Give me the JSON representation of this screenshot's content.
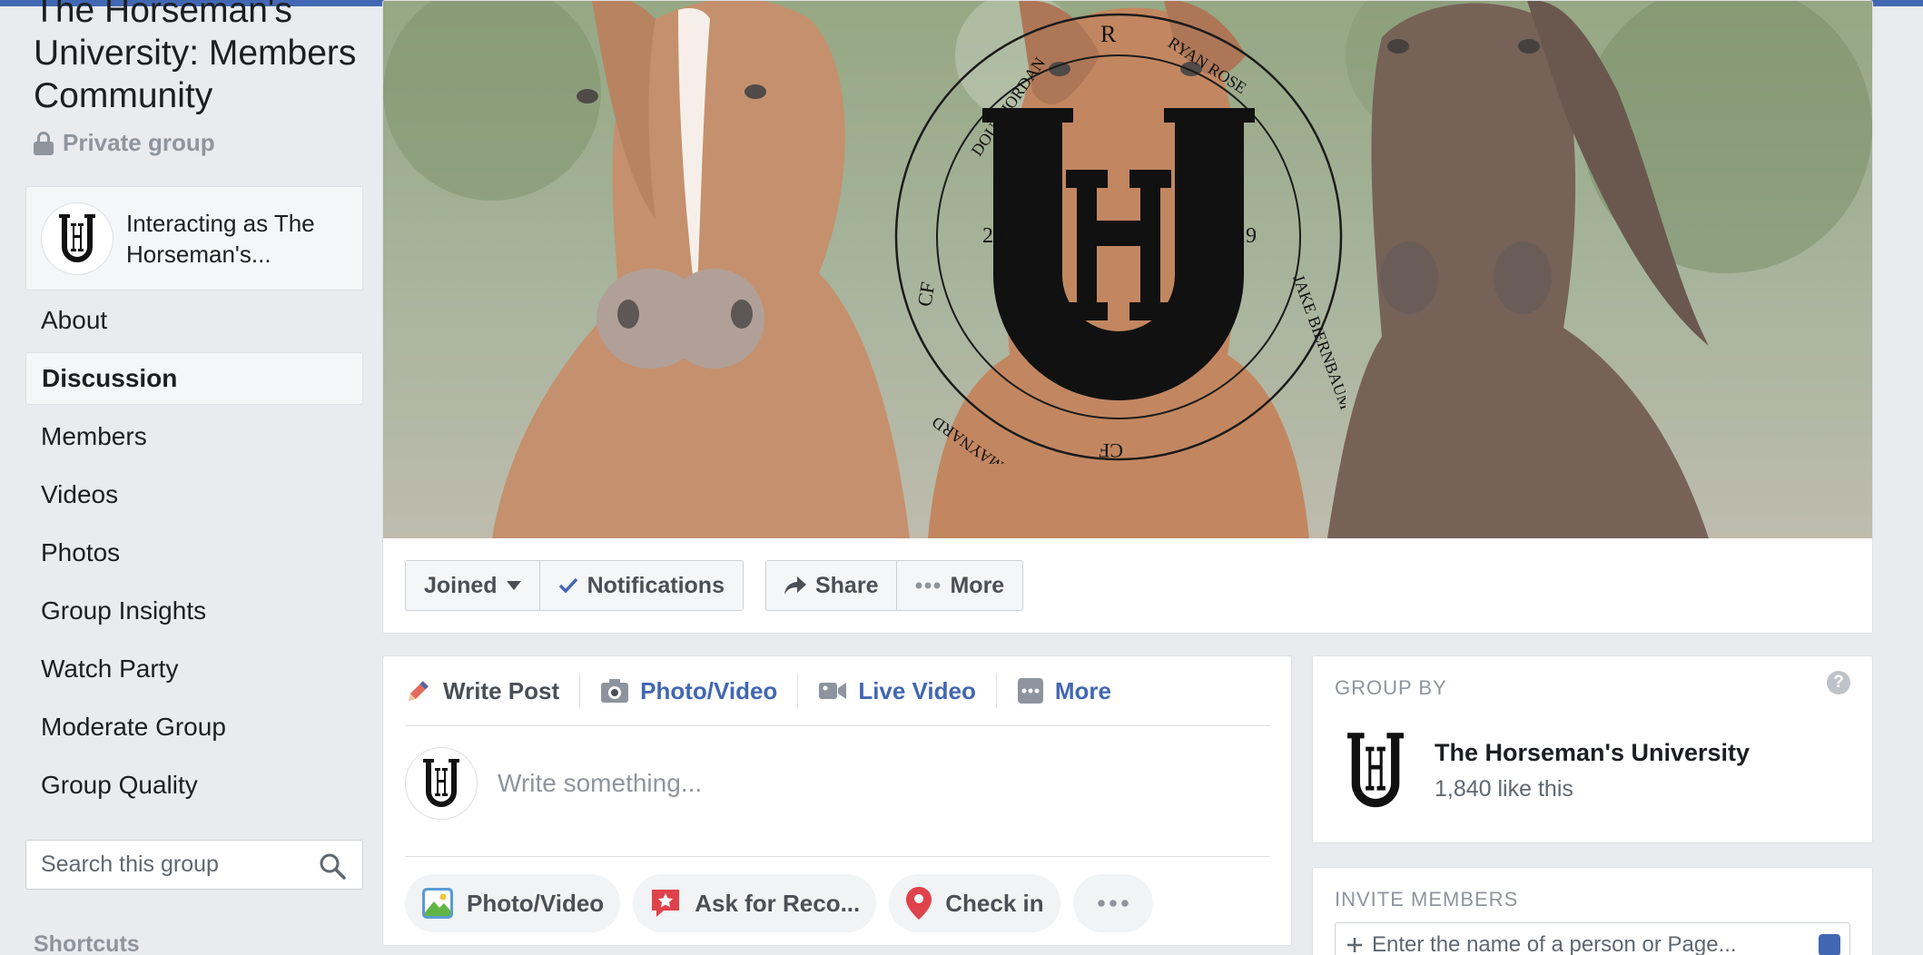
{
  "group": {
    "title": "The Horseman's University: Members Community",
    "privacy": "Private group"
  },
  "interacting": {
    "label": "Interacting as The Horseman's..."
  },
  "nav": {
    "items": [
      {
        "label": "About"
      },
      {
        "label": "Discussion"
      },
      {
        "label": "Members"
      },
      {
        "label": "Videos"
      },
      {
        "label": "Photos"
      },
      {
        "label": "Group Insights"
      },
      {
        "label": "Watch Party"
      },
      {
        "label": "Moderate Group"
      },
      {
        "label": "Group Quality"
      }
    ],
    "active": "Discussion"
  },
  "search": {
    "placeholder": "Search this group"
  },
  "shortcuts": {
    "title": "Shortcuts"
  },
  "cover": {
    "seal": {
      "top_right_text": "RYAN ROSE",
      "top_left_text": "DOUG JORDAN",
      "bottom_right_text": "JAKE BIERNBAUM",
      "bottom_left_text": "TIK MAYNARD",
      "year_left": "20",
      "year_right": "19",
      "monogram": "UH",
      "brand_marks": [
        "R",
        "CF",
        "CF"
      ]
    },
    "actions": {
      "joined": "Joined",
      "notifications": "Notifications",
      "share": "Share",
      "more": "More"
    }
  },
  "composer": {
    "tabs": {
      "write_post": "Write Post",
      "photo_video": "Photo/Video",
      "live_video": "Live Video",
      "more": "More"
    },
    "placeholder": "Write something...",
    "actions": {
      "photo_video": "Photo/Video",
      "ask_for_reco": "Ask for Reco...",
      "check_in": "Check in"
    }
  },
  "group_by": {
    "title": "GROUP BY",
    "page_name": "The Horseman's University",
    "likes": "1,840 like this"
  },
  "invite": {
    "title": "INVITE MEMBERS",
    "placeholder": "Enter the name of a person or Page..."
  },
  "colors": {
    "accent": "#4267b2",
    "background": "#e9ebee"
  }
}
